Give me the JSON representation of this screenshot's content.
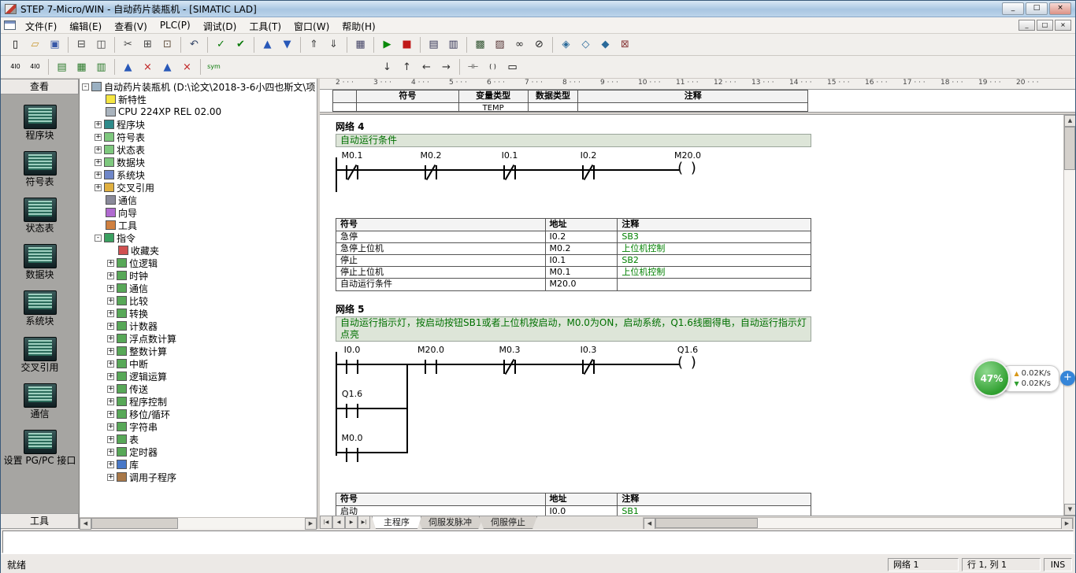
{
  "window": {
    "title": "STEP 7-Micro/WIN - 自动药片装瓶机 - [SIMATIC LAD]",
    "caption_buttons": {
      "minimize": "_",
      "maximize": "□",
      "close": "×"
    },
    "mdi_buttons": {
      "minimize": "_",
      "restore": "□",
      "close": "×"
    }
  },
  "glyphs": {
    "up": "▲",
    "down": "▼",
    "left": "◀",
    "right": "▶",
    "first": "|◀",
    "last": "▶|",
    "tri_up": "▲",
    "tri_down": "▼"
  },
  "menu": {
    "items": [
      {
        "name": "file",
        "label": "文件(F)"
      },
      {
        "name": "edit",
        "label": "编辑(E)"
      },
      {
        "name": "view",
        "label": "查看(V)"
      },
      {
        "name": "plc",
        "label": "PLC(P)"
      },
      {
        "name": "debug",
        "label": "调试(D)"
      },
      {
        "name": "tools",
        "label": "工具(T)"
      },
      {
        "name": "window",
        "label": "窗口(W)"
      },
      {
        "name": "help",
        "label": "帮助(H)"
      }
    ]
  },
  "toolbar_main": [
    {
      "name": "new",
      "g": "▯"
    },
    {
      "name": "open",
      "g": "▱",
      "c": "#c89830"
    },
    {
      "name": "save",
      "g": "▣",
      "c": "#3858a8"
    },
    "|",
    {
      "name": "print",
      "g": "⊟",
      "c": "#444444"
    },
    {
      "name": "print-preview",
      "g": "◫",
      "c": "#444444"
    },
    "|",
    {
      "name": "cut",
      "g": "✂",
      "c": "#444444"
    },
    {
      "name": "copy",
      "g": "⊞",
      "c": "#444444"
    },
    {
      "name": "paste",
      "g": "⊡",
      "c": "#665544"
    },
    "|",
    {
      "name": "undo",
      "g": "↶",
      "c": "#334466"
    },
    "|",
    {
      "name": "compile",
      "g": "✓",
      "c": "#0a7a0a"
    },
    {
      "name": "compile-all",
      "g": "✔",
      "c": "#0a7a0a"
    },
    "|",
    {
      "name": "upload",
      "g": "▲",
      "c": "#2858b8"
    },
    {
      "name": "download",
      "g": "▼",
      "c": "#2858b8"
    },
    "|",
    {
      "name": "sort-ascending",
      "g": "⇑",
      "c": "#444444"
    },
    {
      "name": "sort-descending",
      "g": "⇓",
      "c": "#444444"
    },
    "|",
    {
      "name": "options",
      "g": "▦",
      "c": "#444466"
    },
    "|",
    {
      "name": "run",
      "g": "▶",
      "c": "#0a8a0a"
    },
    {
      "name": "stop",
      "g": "■",
      "c": "#c01818"
    },
    "|",
    {
      "name": "program-status",
      "g": "▤",
      "c": "#333355"
    },
    {
      "name": "chart-status",
      "g": "▥",
      "c": "#333355"
    },
    "|",
    {
      "name": "status-chart",
      "g": "▩",
      "c": "#335533"
    },
    {
      "name": "pause-chart",
      "g": "▨",
      "c": "#553333"
    },
    {
      "name": "glasses",
      "g": "∞",
      "c": "#222222"
    },
    {
      "name": "pause-glasses",
      "g": "⊘",
      "c": "#222222"
    },
    "|",
    {
      "name": "bookmark",
      "g": "◈",
      "c": "#2a6a9a"
    },
    {
      "name": "next-bookmark",
      "g": "◇",
      "c": "#2a6a9a"
    },
    {
      "name": "previous-bookmark",
      "g": "◆",
      "c": "#2a6a9a"
    },
    {
      "name": "clear-bookmark",
      "g": "⊠",
      "c": "#8a3a3a"
    }
  ],
  "toolbar_instr": [
    {
      "name": "absolute-address",
      "g": "4I0",
      "s": 1
    },
    {
      "name": "symbolic-address",
      "g": "4I0",
      "s": 1
    },
    "|",
    {
      "name": "symbol-info-table",
      "g": "▤",
      "c": "#2a7a2a"
    },
    {
      "name": "symbol-table-view",
      "g": "▦",
      "c": "#2a7a2a"
    },
    {
      "name": "poi-view",
      "g": "▥",
      "c": "#2a7a2a"
    },
    "|",
    {
      "name": "insert-row",
      "g": "▲",
      "c": "#2858b8"
    },
    {
      "name": "delete-row",
      "g": "×",
      "c": "#c02020"
    },
    {
      "name": "insert-column",
      "g": "▲",
      "c": "#2858b8"
    },
    {
      "name": "delete-column",
      "g": "×",
      "c": "#c02020"
    },
    "|",
    {
      "name": "symbolic-addressing-toggle",
      "g": "sym",
      "c": "#0a7a0a",
      "s": 1
    },
    "gap",
    {
      "name": "line-down",
      "g": "↓",
      "c": "#333333"
    },
    {
      "name": "line-up",
      "g": "↑",
      "c": "#333333"
    },
    {
      "name": "line-left",
      "g": "←",
      "c": "#333333"
    },
    {
      "name": "line-right",
      "g": "→",
      "c": "#333333"
    },
    "|",
    {
      "name": "insert-contact",
      "g": "⊣⊢",
      "s": 1
    },
    {
      "name": "insert-coil",
      "g": "( )",
      "s": 1
    },
    {
      "name": "insert-box",
      "g": "▭"
    }
  ],
  "view_bar": {
    "title": "查看",
    "footer": "工具",
    "items": [
      {
        "name": "program-block",
        "label": "程序块"
      },
      {
        "name": "symbol-table",
        "label": "符号表"
      },
      {
        "name": "status-chart",
        "label": "状态表"
      },
      {
        "name": "data-block",
        "label": "数据块"
      },
      {
        "name": "system-block",
        "label": "系统块"
      },
      {
        "name": "cross-reference",
        "label": "交叉引用"
      },
      {
        "name": "communication",
        "label": "通信"
      },
      {
        "name": "set-pg-pc-interface",
        "label": "设置 PG/PC 接口"
      }
    ]
  },
  "project_tree": {
    "root": "自动药片装瓶机 (D:\\论文\\2018-3-6小四也斯文\\项",
    "items": [
      {
        "level": 1,
        "exp": "",
        "icon": "qmark",
        "label": "新特性",
        "name": "whats-new"
      },
      {
        "level": 1,
        "exp": "",
        "icon": "cpu",
        "label": "CPU 224XP REL 02.00",
        "name": "cpu"
      },
      {
        "level": 1,
        "exp": "+",
        "icon": "prog",
        "label": "程序块",
        "name": "program-block"
      },
      {
        "level": 1,
        "exp": "+",
        "icon": "table",
        "label": "符号表",
        "name": "symbol-table"
      },
      {
        "level": 1,
        "exp": "+",
        "icon": "table",
        "label": "状态表",
        "name": "status-chart"
      },
      {
        "level": 1,
        "exp": "+",
        "icon": "table",
        "label": "数据块",
        "name": "data-block"
      },
      {
        "level": 1,
        "exp": "+",
        "icon": "sys",
        "label": "系统块",
        "name": "system-block"
      },
      {
        "level": 1,
        "exp": "+",
        "icon": "xref",
        "label": "交叉引用",
        "name": "cross-reference"
      },
      {
        "level": 1,
        "exp": "",
        "icon": "comm",
        "label": "通信",
        "name": "communication"
      },
      {
        "level": 1,
        "exp": "",
        "icon": "wizard",
        "label": "向导",
        "name": "wizard"
      },
      {
        "level": 1,
        "exp": "",
        "icon": "tool",
        "label": "工具",
        "name": "tools"
      },
      {
        "level": 1,
        "exp": "-",
        "icon": "instr",
        "label": "指令",
        "name": "instructions"
      },
      {
        "level": 2,
        "exp": "",
        "icon": "fav",
        "label": "收藏夹",
        "name": "favorites"
      },
      {
        "level": 2,
        "exp": "+",
        "icon": "cat",
        "label": "位逻辑",
        "name": "bit-logic"
      },
      {
        "level": 2,
        "exp": "+",
        "icon": "cat",
        "label": "时钟",
        "name": "clock"
      },
      {
        "level": 2,
        "exp": "+",
        "icon": "cat",
        "label": "通信",
        "name": "comm-instructions"
      },
      {
        "level": 2,
        "exp": "+",
        "icon": "cat",
        "label": "比较",
        "name": "compare"
      },
      {
        "level": 2,
        "exp": "+",
        "icon": "cat",
        "label": "转换",
        "name": "convert"
      },
      {
        "level": 2,
        "exp": "+",
        "icon": "cat",
        "label": "计数器",
        "name": "counters"
      },
      {
        "level": 2,
        "exp": "+",
        "icon": "cat",
        "label": "浮点数计算",
        "name": "float-math"
      },
      {
        "level": 2,
        "exp": "+",
        "icon": "cat",
        "label": "整数计算",
        "name": "integer-math"
      },
      {
        "level": 2,
        "exp": "+",
        "icon": "cat",
        "label": "中断",
        "name": "interrupt"
      },
      {
        "level": 2,
        "exp": "+",
        "icon": "cat",
        "label": "逻辑运算",
        "name": "logic-operations"
      },
      {
        "level": 2,
        "exp": "+",
        "icon": "cat",
        "label": "传送",
        "name": "move"
      },
      {
        "level": 2,
        "exp": "+",
        "icon": "cat",
        "label": "程序控制",
        "name": "program-control"
      },
      {
        "level": 2,
        "exp": "+",
        "icon": "cat",
        "label": "移位/循环",
        "name": "shift-rotate"
      },
      {
        "level": 2,
        "exp": "+",
        "icon": "cat",
        "label": "字符串",
        "name": "string"
      },
      {
        "level": 2,
        "exp": "+",
        "icon": "cat",
        "label": "表",
        "name": "table"
      },
      {
        "level": 2,
        "exp": "+",
        "icon": "cat",
        "label": "定时器",
        "name": "timers"
      },
      {
        "level": 2,
        "exp": "+",
        "icon": "lib",
        "label": "库",
        "name": "libraries"
      },
      {
        "level": 2,
        "exp": "+",
        "icon": "call",
        "label": "调用子程序",
        "name": "call-subroutine"
      }
    ]
  },
  "editor": {
    "ruler_marks": [
      "2",
      "3",
      "4",
      "5",
      "6",
      "7",
      "8",
      "9",
      "10",
      "11",
      "12",
      "13",
      "14",
      "15",
      "16",
      "17",
      "18",
      "19",
      "20"
    ],
    "variable_table": {
      "headers": [
        "符号",
        "变量类型",
        "数据类型",
        "注释"
      ],
      "row_type": "TEMP"
    },
    "networks": [
      {
        "title": "网络 4",
        "comment": "自动运行条件",
        "rung": {
          "contacts": [
            {
              "label": "M0.1",
              "type": "nc"
            },
            {
              "label": "M0.2",
              "type": "nc"
            },
            {
              "label": "I0.1",
              "type": "nc"
            },
            {
              "label": "I0.2",
              "type": "nc"
            }
          ],
          "coil": {
            "label": "M20.0"
          },
          "branches": []
        },
        "symbol_table": {
          "headers": [
            "符号",
            "地址",
            "注释"
          ],
          "rows": [
            [
              "急停",
              "I0.2",
              "SB3"
            ],
            [
              "急停上位机",
              "M0.2",
              "上位机控制"
            ],
            [
              "停止",
              "I0.1",
              "SB2"
            ],
            [
              "停止上位机",
              "M0.1",
              "上位机控制"
            ],
            [
              "自动运行条件",
              "M20.0",
              ""
            ]
          ]
        }
      },
      {
        "title": "网络 5",
        "comment": "自动运行指示灯，按启动按钮SB1或者上位机按启动，M0.0为ON，启动系统，Q1.6线圈得电，自动运行指示灯点亮",
        "rung": {
          "contacts": [
            {
              "label": "I0.0",
              "type": "no"
            },
            {
              "label": "M20.0",
              "type": "no"
            },
            {
              "label": "M0.3",
              "type": "nc"
            },
            {
              "label": "I0.3",
              "type": "nc"
            }
          ],
          "coil": {
            "label": "Q1.6"
          },
          "branches": [
            {
              "label": "Q1.6",
              "type": "no"
            },
            {
              "label": "M0.0",
              "type": "no"
            }
          ]
        },
        "symbol_table": {
          "headers": [
            "符号",
            "地址",
            "注释"
          ],
          "rows": [
            [
              "启动",
              "I0.0",
              "SB1"
            ]
          ]
        }
      }
    ],
    "tabs": [
      {
        "name": "main-program",
        "label": "主程序",
        "active": true
      },
      {
        "name": "servo-pulse",
        "label": "伺服发脉冲",
        "active": false
      },
      {
        "name": "servo-stop",
        "label": "伺服停止",
        "active": false
      }
    ]
  },
  "status_bar": {
    "ready": "就绪",
    "network": "网络 1",
    "position": "行 1, 列 1",
    "mode": "INS"
  },
  "overlay": {
    "percent": "47%",
    "up_speed": "0.02K/s",
    "down_speed": "0.02K/s",
    "plus": "+"
  }
}
